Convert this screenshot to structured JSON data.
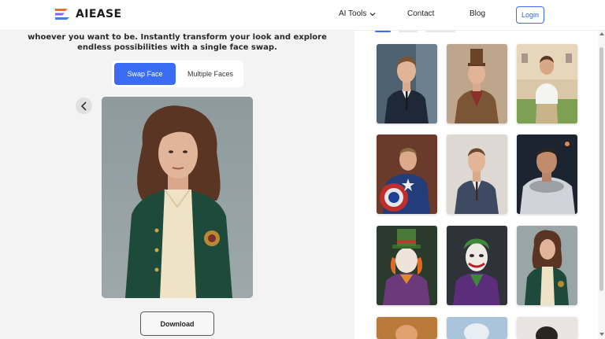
{
  "header": {
    "brand": "AIEASE",
    "nav": {
      "ai_tools": "AI Tools",
      "contact": "Contact",
      "blog": "Blog"
    },
    "login": "Login"
  },
  "hero": {
    "tagline": "whoever you want to be. Instantly transform your look and explore endless possibilities with a single face swap."
  },
  "modes": {
    "active": "Swap Face",
    "inactive": "Multiple Faces"
  },
  "actions": {
    "download": "Download"
  },
  "colors": {
    "accent": "#3b6cf6",
    "brand_orange": "#f46a34",
    "brand_purple": "#8b5cf6"
  },
  "icons": {
    "prev": "chevron-left-icon",
    "dropdown": "chevron-down-icon"
  }
}
